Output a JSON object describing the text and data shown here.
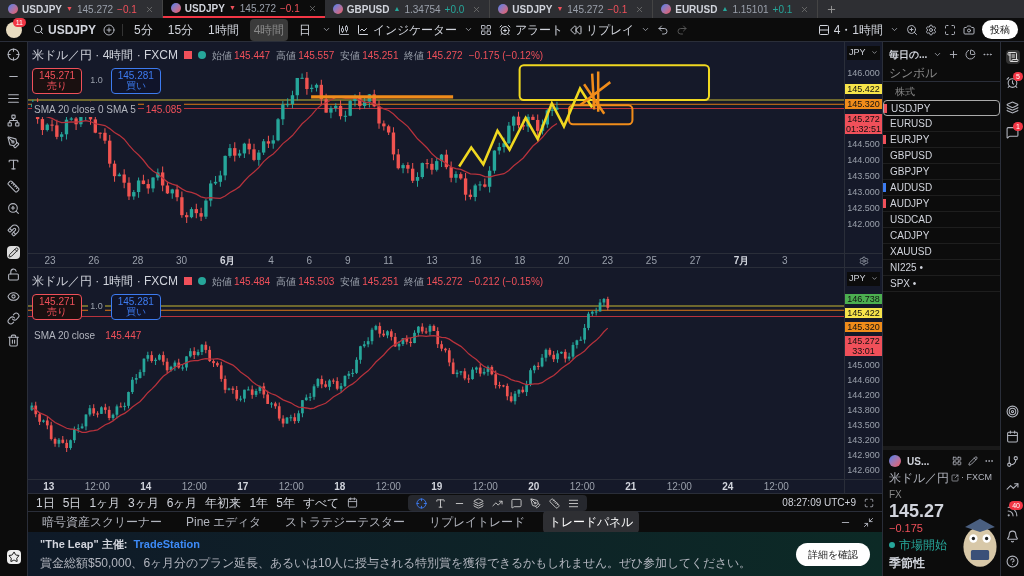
{
  "tabs": [
    {
      "symbol": "USDJPY",
      "arrow": "▼",
      "color": "#f0505a",
      "price": "145.272",
      "change": "−0.1",
      "selected": false
    },
    {
      "symbol": "USDJPY",
      "arrow": "▼",
      "color": "#f0505a",
      "price": "145.272",
      "change": "−0.1",
      "selected": true
    },
    {
      "symbol": "GBPUSD",
      "arrow": "▲",
      "color": "#26a69a",
      "price": "1.34754",
      "change": "+0.0",
      "selected": false
    },
    {
      "symbol": "USDJPY",
      "arrow": "▼",
      "color": "#f0505a",
      "price": "145.272",
      "change": "−0.1",
      "selected": false
    },
    {
      "symbol": "EURUSD",
      "arrow": "▲",
      "color": "#26a69a",
      "price": "1.15101",
      "change": "+0.1",
      "selected": false
    }
  ],
  "toolbar": {
    "badge": "11",
    "symbol": "USDJPY",
    "intervals": [
      {
        "label": "5分",
        "selected": false
      },
      {
        "label": "15分",
        "selected": false
      },
      {
        "label": "1時間",
        "selected": false
      },
      {
        "label": "4時間",
        "selected": true
      },
      {
        "label": "日",
        "selected": false
      }
    ],
    "indicators": "インジケーター",
    "alerts": "アラート",
    "replay": "リプレイ",
    "layout": "4・1時間",
    "post": "投稿"
  },
  "panes": [
    {
      "title": "米ドル／円 · 4時間 · FXCM",
      "ohlc": [
        {
          "label": "始値",
          "value": "145.447"
        },
        {
          "label": "高値",
          "value": "145.557"
        },
        {
          "label": "安値",
          "value": "145.251"
        },
        {
          "label": "終値",
          "value": "145.272"
        }
      ],
      "change": "−0.175 (−0.12%)",
      "sell": {
        "price": "145.271",
        "label": "売り"
      },
      "spread": "1.0",
      "buy": {
        "price": "145.281",
        "label": "買い"
      },
      "indicator": {
        "label": "SMA 20 close 0 SMA 5",
        "value": "145.085"
      },
      "currency": "JPY",
      "price_labels": [
        {
          "text": "146.000"
        },
        {
          "text": "145.422",
          "color": "#f7e44a"
        },
        {
          "text": "145.320",
          "color": "#f08c1a"
        },
        {
          "text": "145.272",
          "sub": "01:32:51",
          "color": "#f0505a"
        },
        {
          "text": "144.500"
        },
        {
          "text": "144.000"
        },
        {
          "text": "143.500"
        },
        {
          "text": "143.000"
        },
        {
          "text": "142.500"
        },
        {
          "text": "142.000"
        }
      ],
      "dates": [
        {
          "text": "23",
          "bold": false
        },
        {
          "text": "26",
          "bold": false
        },
        {
          "text": "28",
          "bold": false
        },
        {
          "text": "30",
          "bold": false
        },
        {
          "text": "6月",
          "bold": true
        },
        {
          "text": "4",
          "bold": false
        },
        {
          "text": "6",
          "bold": false
        },
        {
          "text": "9",
          "bold": false
        },
        {
          "text": "11",
          "bold": false
        },
        {
          "text": "13",
          "bold": false
        },
        {
          "text": "16",
          "bold": false
        },
        {
          "text": "18",
          "bold": false
        },
        {
          "text": "20",
          "bold": false
        },
        {
          "text": "23",
          "bold": false
        },
        {
          "text": "25",
          "bold": false
        },
        {
          "text": "27",
          "bold": false
        },
        {
          "text": "7月",
          "bold": true
        },
        {
          "text": "3",
          "bold": false
        }
      ]
    },
    {
      "title": "米ドル／円 · 1時間 · FXCM",
      "ohlc": [
        {
          "label": "始値",
          "value": "145.484"
        },
        {
          "label": "高値",
          "value": "145.503"
        },
        {
          "label": "安値",
          "value": "145.251"
        },
        {
          "label": "終値",
          "value": "145.272"
        }
      ],
      "change": "−0.212 (−0.15%)",
      "sell": {
        "price": "145.271",
        "label": "売り"
      },
      "spread": "1.0",
      "buy": {
        "price": "145.281",
        "label": "買い"
      },
      "indicator": {
        "label": "SMA 20 close",
        "value": "145.447"
      },
      "currency": "JPY",
      "price_labels": [
        {
          "text": "146.738",
          "color": "#4caf50"
        },
        {
          "text": "145.422",
          "color": "#f7e44a"
        },
        {
          "text": "145.320",
          "color": "#f08c1a"
        },
        {
          "text": "145.272",
          "sub": "33:01",
          "color": "#f0505a"
        },
        {
          "text": "145.000"
        },
        {
          "text": "144.600"
        },
        {
          "text": "144.200"
        },
        {
          "text": "143.800"
        },
        {
          "text": "143.500"
        },
        {
          "text": "143.200"
        },
        {
          "text": "142.900"
        },
        {
          "text": "142.600"
        }
      ],
      "dates": [
        {
          "text": "13",
          "bold": true
        },
        {
          "text": "12:00",
          "bold": false
        },
        {
          "text": "14",
          "bold": true
        },
        {
          "text": "12:00",
          "bold": false
        },
        {
          "text": "17",
          "bold": true
        },
        {
          "text": "12:00",
          "bold": false
        },
        {
          "text": "18",
          "bold": true
        },
        {
          "text": "12:00",
          "bold": false
        },
        {
          "text": "19",
          "bold": true
        },
        {
          "text": "12:00",
          "bold": false
        },
        {
          "text": "20",
          "bold": true
        },
        {
          "text": "12:00",
          "bold": false
        },
        {
          "text": "21",
          "bold": true
        },
        {
          "text": "12:00",
          "bold": false
        },
        {
          "text": "24",
          "bold": true
        },
        {
          "text": "12:00",
          "bold": false
        }
      ]
    }
  ],
  "ranges": [
    "1日",
    "5日",
    "1ヶ月",
    "3ヶ月",
    "6ヶ月",
    "年初来",
    "1年",
    "5年",
    "すべて"
  ],
  "clock": "08:27:09 UTC+9",
  "panel_tabs": [
    {
      "label": "暗号資産スクリーナー",
      "selected": false
    },
    {
      "label": "Pine エディタ",
      "selected": false
    },
    {
      "label": "ストラテジーテスター",
      "selected": false
    },
    {
      "label": "リプレイトレード",
      "selected": false
    },
    {
      "label": "トレードパネル",
      "selected": true
    }
  ],
  "banner": {
    "title": "\"The Leap\" 主催:",
    "brand": "TradeStation",
    "body": "賞金総額$50,000、6ヶ月分のプラン延長、あるいは10人に授与される特別賞を獲得できるかもしれません。ぜひ参加してください。",
    "button": "詳細を確認"
  },
  "watchlist": {
    "title": "毎日の...",
    "column": "シンボル",
    "section": "株式",
    "items": [
      {
        "symbol": "USDJPY",
        "selected": true,
        "color": "#f0505a"
      },
      {
        "symbol": "EURUSD",
        "selected": false
      },
      {
        "symbol": "EURJPY",
        "selected": false,
        "color": "#f0505a"
      },
      {
        "symbol": "GBPUSD",
        "selected": false
      },
      {
        "symbol": "GBPJPY",
        "selected": false
      },
      {
        "symbol": "AUDUSD",
        "selected": false,
        "color": "#3d7bf0"
      },
      {
        "symbol": "AUDJPY",
        "selected": false,
        "color": "#f0505a"
      },
      {
        "symbol": "USDCAD",
        "selected": false
      },
      {
        "symbol": "CADJPY",
        "selected": false
      },
      {
        "symbol": "XAUUSD",
        "selected": false
      },
      {
        "symbol": "NI225 •",
        "selected": false
      },
      {
        "symbol": "SPX •",
        "selected": false
      }
    ]
  },
  "detail": {
    "symbol": "US...",
    "name": "米ドル／円",
    "exchange": "· FXCM",
    "type": "FX",
    "price": "145.27",
    "change": "−0.175",
    "status": "市場開始",
    "section": "季節性"
  },
  "badges": {
    "alerts": "5",
    "chat": "1",
    "feed": "40"
  }
}
